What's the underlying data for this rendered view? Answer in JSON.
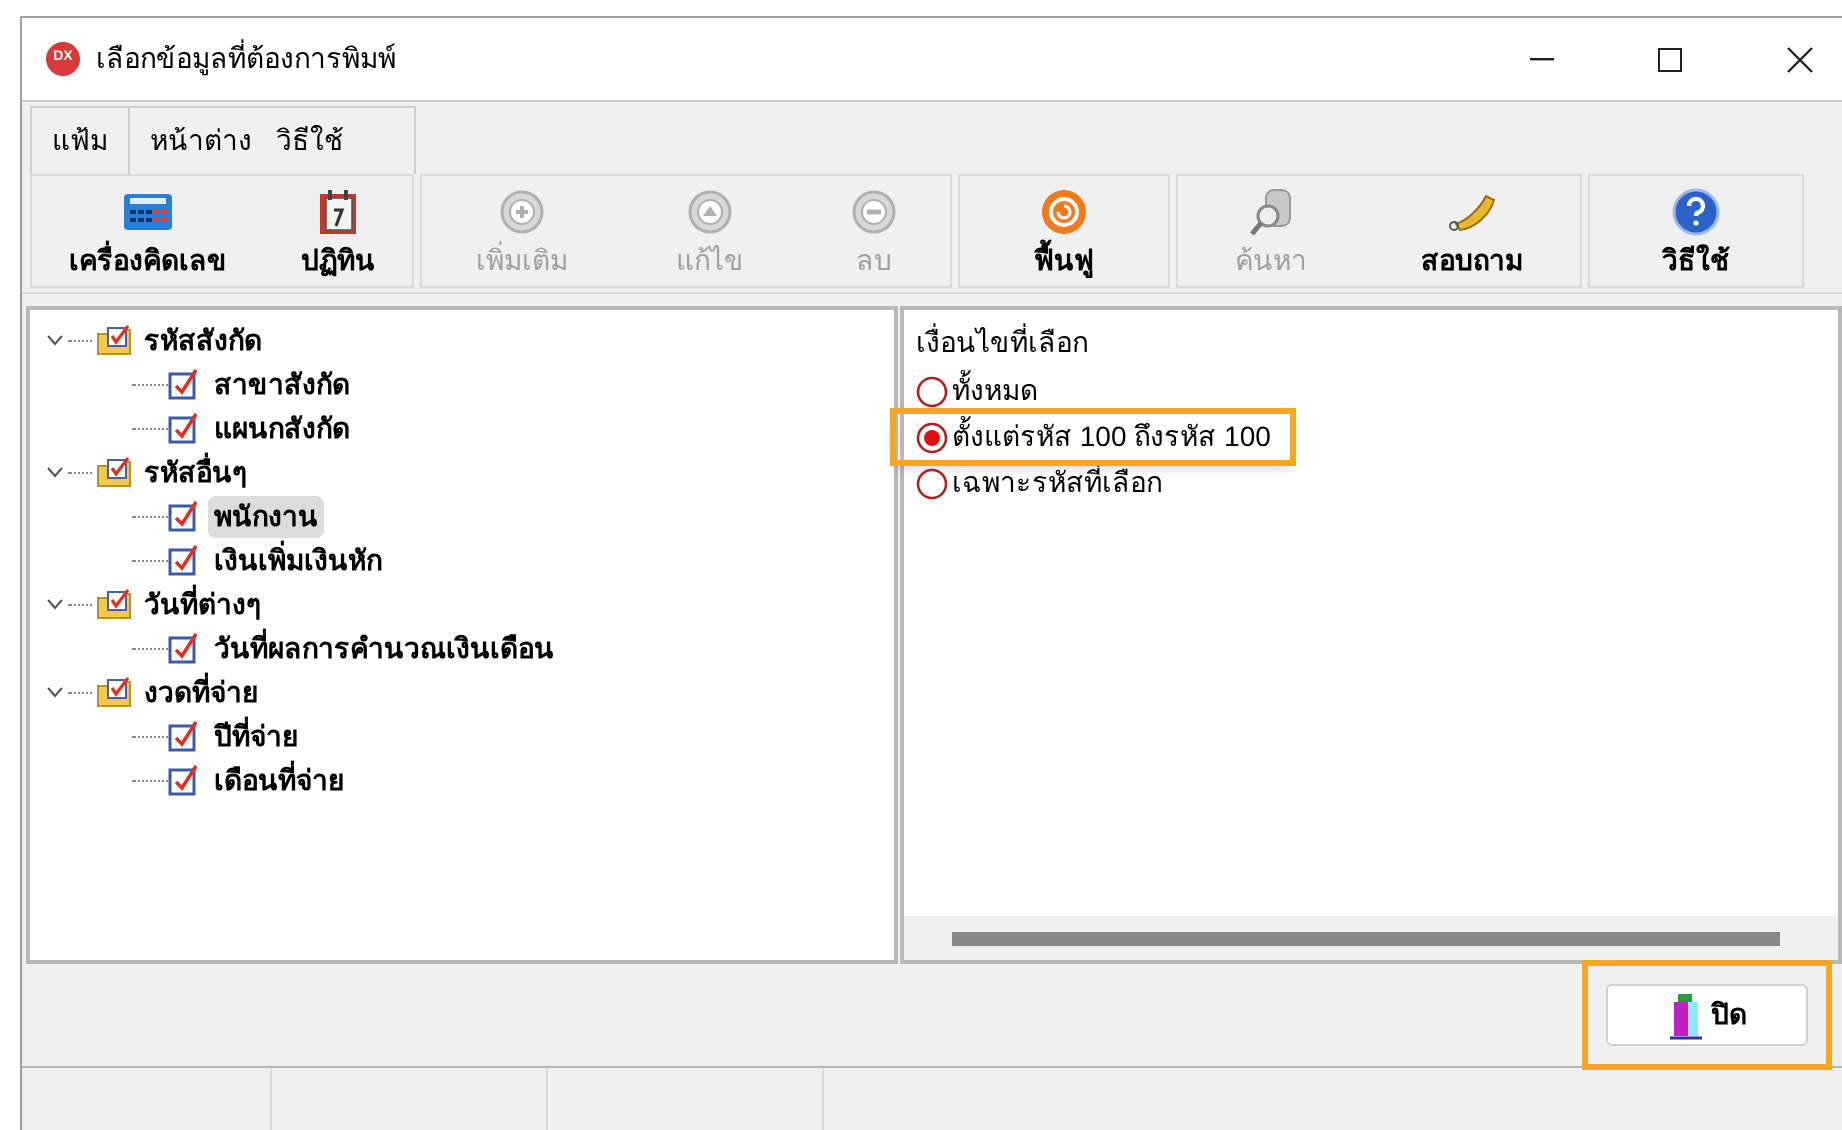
{
  "window": {
    "app_icon": "DX",
    "title": "เลือกข้อมูลที่ต้องการพิมพ์"
  },
  "menu_groups": [
    {
      "items": [
        {
          "label": "แฟ้ม"
        }
      ]
    },
    {
      "items": [
        {
          "label": "หน้าต่าง"
        },
        {
          "label": "วิธีใช้"
        }
      ]
    }
  ],
  "toolbar_groups": [
    {
      "buttons": [
        {
          "kind": "calculator",
          "label": "เครื่องคิดเลข",
          "disabled": false
        },
        {
          "kind": "calendar",
          "label": "ปฏิทิน",
          "disabled": false
        }
      ]
    },
    {
      "buttons": [
        {
          "kind": "add",
          "label": "เพิ่มเติม",
          "disabled": true
        },
        {
          "kind": "edit",
          "label": "แก้ไข",
          "disabled": true
        },
        {
          "kind": "delete",
          "label": "ลบ",
          "disabled": true
        }
      ]
    },
    {
      "buttons": [
        {
          "kind": "restore",
          "label": "ฟื้นฟู",
          "disabled": false
        }
      ]
    },
    {
      "buttons": [
        {
          "kind": "search",
          "label": "ค้นหา",
          "disabled": true
        },
        {
          "kind": "phone",
          "label": "สอบถาม",
          "disabled": false
        }
      ]
    },
    {
      "buttons": [
        {
          "kind": "help",
          "label": "วิธีใช้",
          "disabled": false
        }
      ]
    }
  ],
  "tree": [
    {
      "label": "รหัสสังกัด",
      "expanded": true,
      "checked": true,
      "selected": false,
      "children": [
        {
          "label": "สาขาสังกัด",
          "checked": true,
          "selected": false
        },
        {
          "label": "แผนกสังกัด",
          "checked": true,
          "selected": false
        }
      ]
    },
    {
      "label": "รหัสอื่นๆ",
      "expanded": true,
      "checked": true,
      "selected": false,
      "children": [
        {
          "label": "พนักงาน",
          "checked": true,
          "selected": true
        },
        {
          "label": "เงินเพิ่มเงินหัก",
          "checked": true,
          "selected": false
        }
      ]
    },
    {
      "label": "วันที่ต่างๆ",
      "expanded": true,
      "checked": true,
      "selected": false,
      "children": [
        {
          "label": "วันที่ผลการคำนวณเงินเดือน",
          "checked": true,
          "selected": false
        }
      ]
    },
    {
      "label": "งวดที่จ่าย",
      "expanded": true,
      "checked": true,
      "selected": false,
      "children": [
        {
          "label": "ปีที่จ่าย",
          "checked": true,
          "selected": false
        },
        {
          "label": "เดือนที่จ่าย",
          "checked": true,
          "selected": false
        }
      ]
    }
  ],
  "conditions": {
    "title": "เงื่อนไขที่เลือก",
    "options": [
      {
        "label": "ทั้งหมด",
        "selected": false,
        "highlighted": false
      },
      {
        "label": "ตั้งแต่รหัส 100 ถึงรหัส 100",
        "selected": true,
        "highlighted": true
      },
      {
        "label": "เฉพาะรหัสที่เลือก",
        "selected": false,
        "highlighted": false
      }
    ]
  },
  "close_button": {
    "label": "ปิด",
    "highlighted": true
  }
}
